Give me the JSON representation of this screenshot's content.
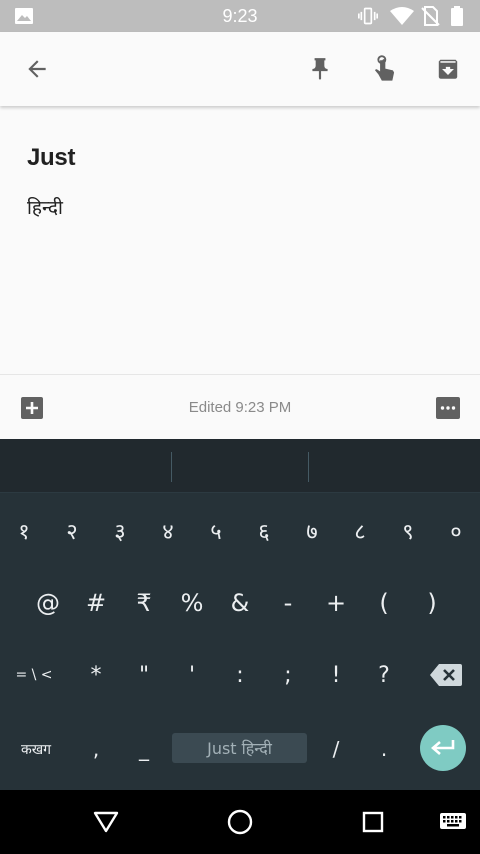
{
  "status_bar": {
    "time": "9:23",
    "icons": [
      "image-icon",
      "vibrate-icon",
      "wifi-icon",
      "no-sim-icon",
      "battery-icon"
    ]
  },
  "toolbar": {
    "icons": [
      "back-arrow-icon",
      "pin-icon",
      "reminder-hand-icon",
      "archive-icon"
    ]
  },
  "note": {
    "title": "Just",
    "body": "हिन्दी"
  },
  "bottom_bar": {
    "edited": "Edited 9:23 PM",
    "icons": [
      "add-box-icon",
      "more-icon"
    ]
  },
  "keyboard": {
    "row1": [
      "१",
      "२",
      "३",
      "४",
      "५",
      "६",
      "७",
      "८",
      "९",
      "०"
    ],
    "row2": [
      "@",
      "#",
      "₹",
      "%",
      "&",
      "-",
      "+",
      "(",
      ")"
    ],
    "row3": [
      "= \\ <",
      "*",
      "\"",
      "'",
      ":",
      ";",
      "!",
      "?"
    ],
    "row4": {
      "lang_key": "कखग",
      "comma": ",",
      "underscore": "_",
      "space": "Just हिन्दी",
      "slash": "/",
      "period": "."
    },
    "colors": {
      "background": "#263238",
      "enter": "#7fcbc3"
    }
  },
  "nav_bar": {
    "icons": [
      "back-triangle-icon",
      "home-circle-icon",
      "recents-square-icon",
      "keyboard-switch-icon"
    ]
  }
}
